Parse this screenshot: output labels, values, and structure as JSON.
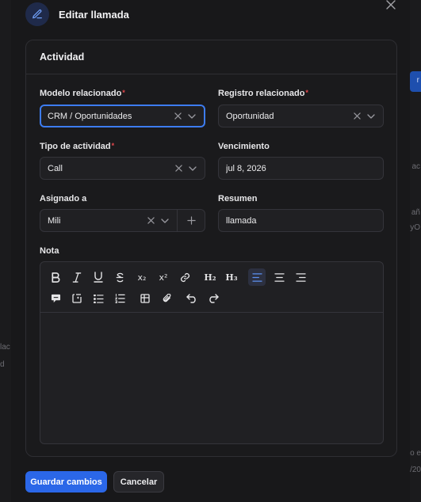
{
  "modal": {
    "title": "Editar llamada",
    "section_title": "Actividad"
  },
  "fields": {
    "modelo": {
      "label": "Modelo relacionado",
      "required_mark": "*",
      "value": "CRM / Oportunidades"
    },
    "registro": {
      "label": "Registro relacionado",
      "required_mark": "*",
      "value": "Oportunidad"
    },
    "tipo": {
      "label": "Tipo de actividad",
      "required_mark": "*",
      "value": "Call"
    },
    "vencimiento": {
      "label": "Vencimiento",
      "value": "jul 8, 2026"
    },
    "asignado": {
      "label": "Asignado a",
      "value": "Mili"
    },
    "resumen": {
      "label": "Resumen",
      "value": "llamada"
    },
    "nota": {
      "label": "Nota"
    }
  },
  "toolbar": {
    "subscript": "x₂",
    "superscript": "x²",
    "h2": "H₂",
    "h3": "H₃"
  },
  "actions": {
    "save_label": "Guardar cambios",
    "cancel_label": "Cancelar"
  },
  "background": {
    "snippets": [
      "r",
      "ac",
      "añ",
      "yO",
      "lac",
      "d",
      "lo e",
      "/20"
    ]
  },
  "colors": {
    "accent": "#2b67e8",
    "focus": "#3d7cf0",
    "required": "#e5484d"
  }
}
